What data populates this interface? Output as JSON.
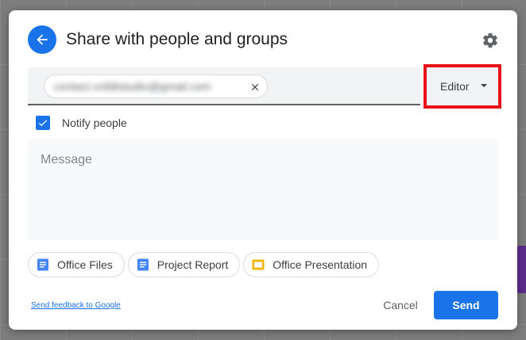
{
  "dialog": {
    "title": "Share with people and groups"
  },
  "recipients": [
    {
      "email": "contact.vofdilstudio@gmail.com",
      "obscured": true
    }
  ],
  "role": {
    "selected": "Editor"
  },
  "notify": {
    "label": "Notify people",
    "checked": true
  },
  "message": {
    "placeholder": "Message",
    "value": ""
  },
  "files": [
    {
      "name": "Office Files",
      "icon": "google-docs-icon",
      "color": "#4285f4"
    },
    {
      "name": "Project Report",
      "icon": "google-docs-icon",
      "color": "#4285f4"
    },
    {
      "name": "Office Presentation",
      "icon": "google-slides-icon",
      "color": "#f4b400"
    }
  ],
  "footer": {
    "feedback_label": "Send feedback to Google",
    "cancel_label": "Cancel",
    "send_label": "Send"
  },
  "colors": {
    "accent": "#1a73e8",
    "highlight_border": "#e8121a"
  }
}
